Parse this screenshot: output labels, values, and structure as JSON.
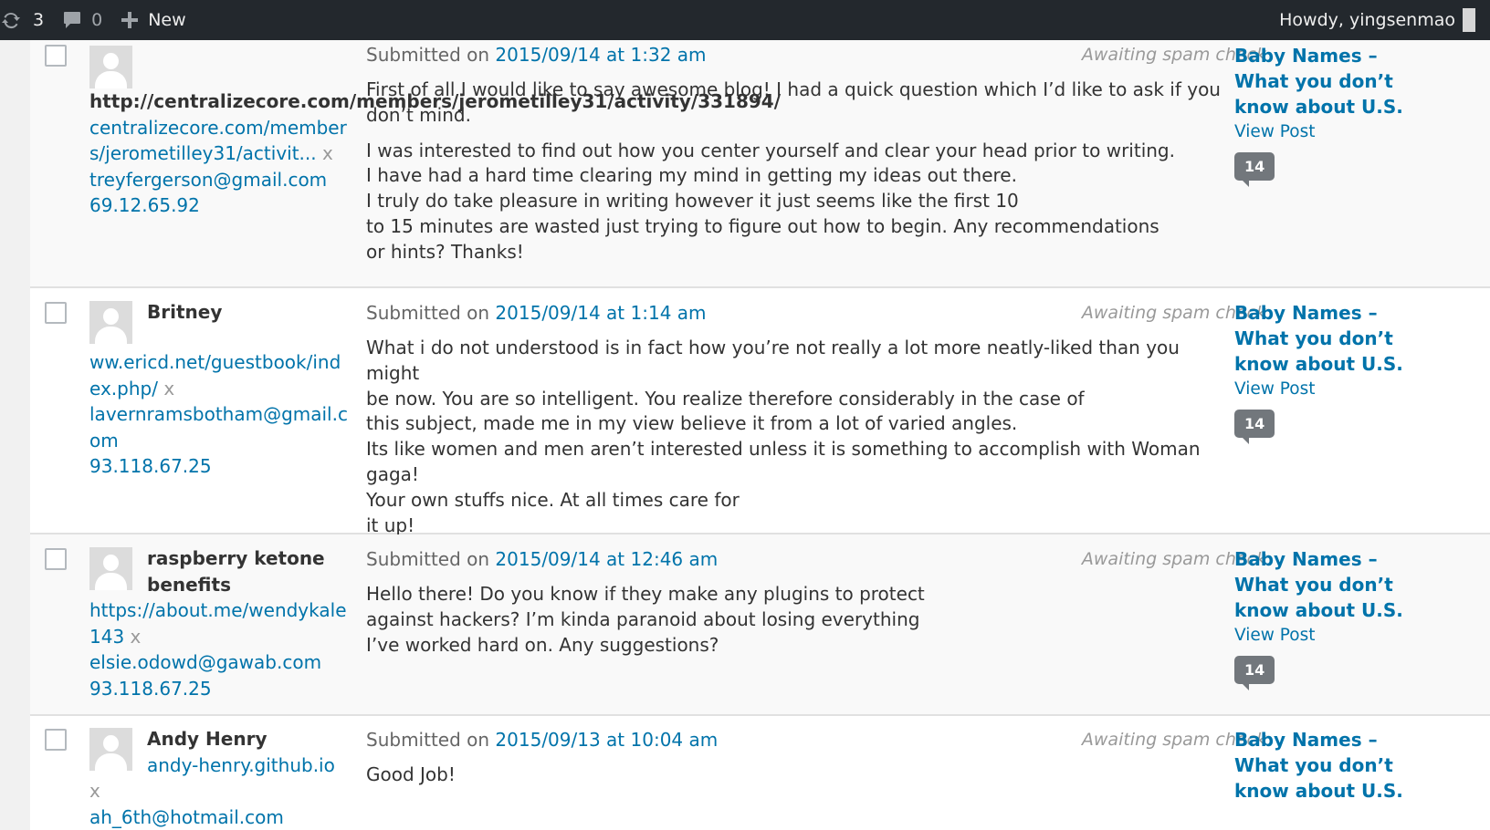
{
  "adminbar": {
    "updates_count": "3",
    "comments_count": "0",
    "new_label": "New",
    "howdy": "Howdy, yingsenmao"
  },
  "common": {
    "submitted_prefix": "Submitted on",
    "status": "Awaiting spam check",
    "response_title": "Baby Names – What you don’t know about U.S.",
    "view_post": "View Post",
    "comment_count": "14",
    "remove_mark": "x"
  },
  "comments": [
    {
      "author_name": "http://centralizecore.com/members/jerometilley31/activity/331894/",
      "url": "centralizecore.com/members/jerometilley31/activit...",
      "email": "treyfergerson@gmail.com",
      "ip": "69.12.65.92",
      "date": "2015/09/14 at 1:32 am",
      "paragraphs": [
        [
          "First of all I would like to say awesome blog! I had a quick question which I’d like to ask if you don’t mind."
        ],
        [
          "I was interested to find out how you center yourself and clear your head prior to writing.",
          "I have had a hard time clearing my mind in getting my ideas out there.",
          "I truly do take pleasure in writing however it just seems like the first 10",
          "to 15 minutes are wasted just trying to figure out how to begin. Any recommendations",
          "or hints? Thanks!"
        ]
      ]
    },
    {
      "author_name": "Britney",
      "url": "ww.ericd.net/guestbook/index.php/",
      "email": "lavernramsbotham@gmail.com",
      "ip": "93.118.67.25",
      "date": "2015/09/14 at 1:14 am",
      "paragraphs": [
        [
          "What i do not understood is in fact how you’re not really a lot more neatly-liked than you might",
          "be now. You are so intelligent. You realize therefore considerably in the case of",
          "this subject, made me in my view believe it from a lot of varied angles.",
          "Its like women and men aren’t interested unless it is something to accomplish with Woman gaga!",
          "Your own stuffs nice. At all times care for",
          "it up!"
        ]
      ]
    },
    {
      "author_name": "raspberry ketone benefits",
      "url": "https://about.me/wendykale143",
      "email": "elsie.odowd@gawab.com",
      "ip": "93.118.67.25",
      "date": "2015/09/14 at 12:46 am",
      "paragraphs": [
        [
          "Hello there! Do you know if they make any plugins to protect",
          "against hackers? I’m kinda paranoid about losing everything",
          "I’ve worked hard on. Any suggestions?"
        ]
      ]
    },
    {
      "author_name": "Andy Henry",
      "url": "andy-henry.github.io",
      "email": "ah_6th@hotmail.com",
      "ip": "",
      "date": "2015/09/13 at 10:04 am",
      "paragraphs": [
        [
          "Good Job!"
        ]
      ]
    }
  ]
}
